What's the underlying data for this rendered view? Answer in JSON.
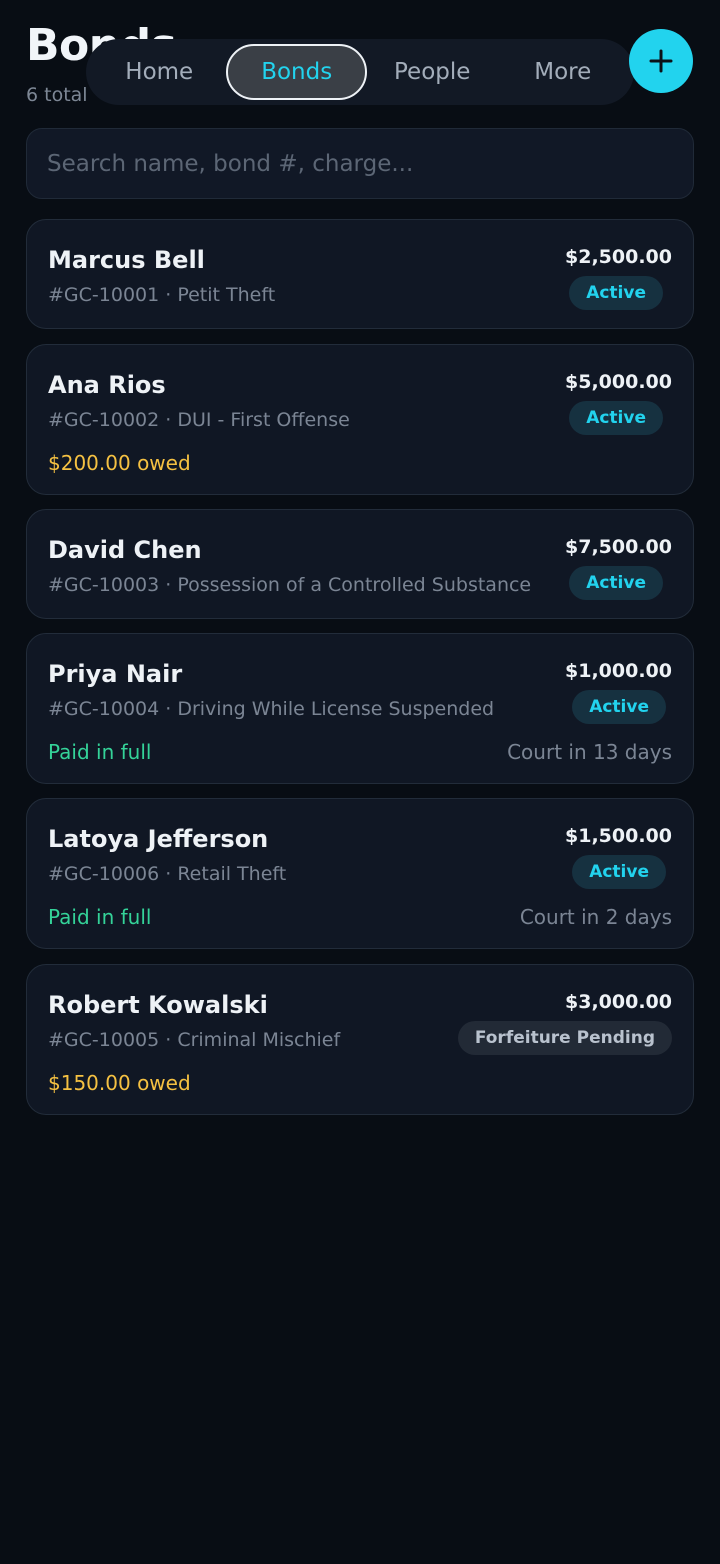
{
  "header": {
    "title": "Bonds",
    "count": "6 total"
  },
  "nav": {
    "tabs": [
      {
        "label": "Home",
        "active": false
      },
      {
        "label": "Bonds",
        "active": true
      },
      {
        "label": "People",
        "active": false
      },
      {
        "label": "More",
        "active": false
      }
    ],
    "add_icon": "plus-icon"
  },
  "search": {
    "placeholder": "Search name, bond #, charge...",
    "value": ""
  },
  "bonds": [
    {
      "name": "Marcus Bell",
      "sub": "#GC-10001 · Petit Theft",
      "amount": "$2,500.00",
      "status": "Active",
      "balance": "",
      "court": ""
    },
    {
      "name": "Ana Rios",
      "sub": "#GC-10002 · DUI - First Offense",
      "amount": "$5,000.00",
      "status": "Active",
      "balance": "$200.00 owed",
      "court": ""
    },
    {
      "name": "David Chen",
      "sub": "#GC-10003 · Possession of a Controlled Substance",
      "amount": "$7,500.00",
      "status": "Active",
      "balance": "",
      "court": ""
    },
    {
      "name": "Priya Nair",
      "sub": "#GC-10004 · Driving While License Suspended",
      "amount": "$1,000.00",
      "status": "Active",
      "balance": "Paid in full",
      "court": "Court in 13 days"
    },
    {
      "name": "Latoya Jefferson",
      "sub": "#GC-10006 · Retail Theft",
      "amount": "$1,500.00",
      "status": "Active",
      "balance": "Paid in full",
      "court": "Court in 2 days"
    },
    {
      "name": "Robert Kowalski",
      "sub": "#GC-10005 · Criminal Mischief",
      "amount": "$3,000.00",
      "status": "Forfeiture Pending",
      "balance": "$150.00 owed",
      "court": ""
    }
  ],
  "colors": {
    "accent": "#22d3ee",
    "owed": "#f5c142",
    "paid": "#34d399",
    "background": "#080d14",
    "card": "#101724"
  }
}
